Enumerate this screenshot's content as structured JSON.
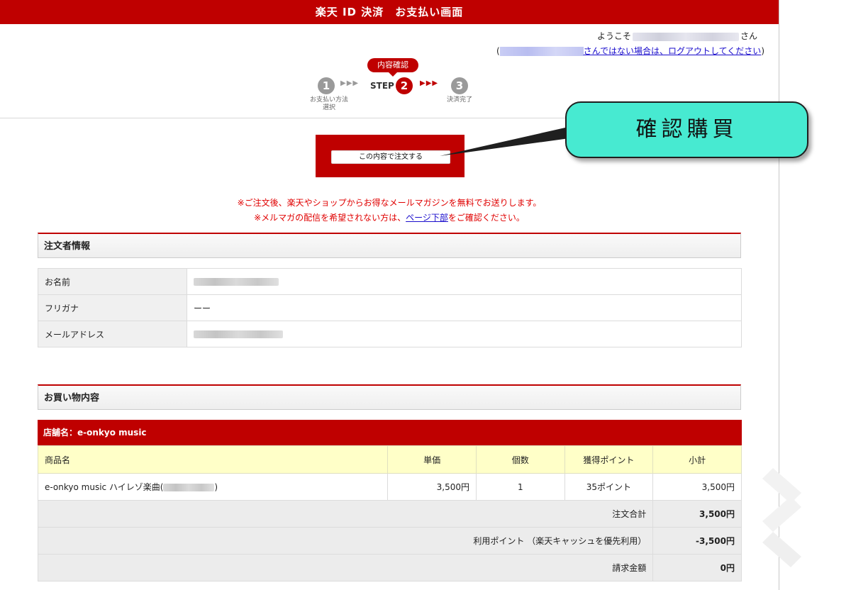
{
  "header": {
    "title": "楽天 ID 決済　お支払い画面"
  },
  "user": {
    "welcome_prefix": "ようこそ",
    "welcome_suffix": "さん",
    "logout_open": "(",
    "logout_text": "さんではない場合は、ログアウトしてください",
    "logout_close": ")"
  },
  "steps": {
    "current_badge": "内容確認",
    "step_label": "STEP",
    "items": [
      {
        "number": "1",
        "caption_line1": "お支払い方法",
        "caption_line2": "選択"
      },
      {
        "number": "2"
      },
      {
        "number": "3",
        "caption_line1": "決済完了"
      }
    ],
    "arrows": "▶▶▶"
  },
  "order": {
    "button_label": "この内容で注文する"
  },
  "callout": {
    "text": "確認購買",
    "fill": "#47ead1"
  },
  "notices": {
    "line1": "※ご注文後、楽天やショップからお得なメールマガジンを無料でお送りします。",
    "line2_prefix": "※メルマガの配信を希望されない方は、",
    "line2_link": "ページ下部",
    "line2_suffix": "をご確認ください。"
  },
  "orderer": {
    "section_title": "注文者情報",
    "rows": [
      {
        "label": "お名前"
      },
      {
        "label": "フリガナ",
        "value": "ーー"
      },
      {
        "label": "メールアドレス"
      }
    ]
  },
  "shopping": {
    "section_title": "お買い物内容",
    "shop_name": "店舗名：e-onkyo music",
    "columns": [
      "商品名",
      "単価",
      "個数",
      "獲得ポイント",
      "小計"
    ],
    "item": {
      "name_prefix": "e-onkyo music ハイレゾ楽曲(",
      "name_suffix": ")",
      "unit_price": "3,500円",
      "quantity": "1",
      "points": "35ポイント",
      "subtotal": "3,500円"
    },
    "summary": [
      {
        "label": "注文合計",
        "value": "3,500円"
      },
      {
        "label": "利用ポイント （楽天キャッシュを優先利用）",
        "value": "-3,500円"
      },
      {
        "label": "請求金額",
        "value": "0円"
      }
    ]
  },
  "colors": {
    "brand_red": "#bf0000",
    "link_blue": "#1a0dcc",
    "notice_red": "#e00000"
  }
}
